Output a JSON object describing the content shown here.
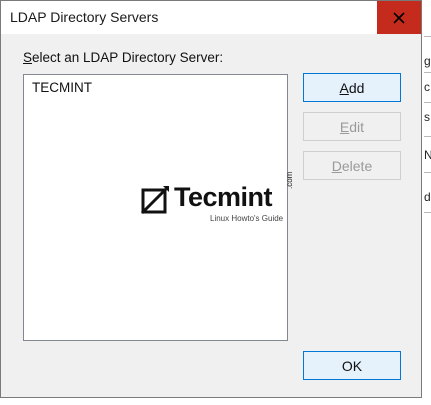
{
  "dialog": {
    "title": "LDAP Directory Servers",
    "caption_underline": "S",
    "caption_rest": "elect an LDAP Directory Server:",
    "servers": [
      "TECMINT"
    ],
    "buttons": {
      "add_ul": "A",
      "add_rest": "dd",
      "edit_ul": "E",
      "edit_rest": "dit",
      "delete_ul": "D",
      "delete_rest": "elete",
      "ok": "OK"
    }
  },
  "watermark": {
    "brand": "Tecmint",
    "suffix": ".com",
    "tagline": "Linux Howto's Guide"
  },
  "background": {
    "chars": [
      "g",
      "c",
      "s",
      "N",
      "d"
    ]
  },
  "colors": {
    "close_bg": "#c42b1c",
    "primary_border": "#0078d7",
    "dialog_bg": "#f0f0f0"
  }
}
